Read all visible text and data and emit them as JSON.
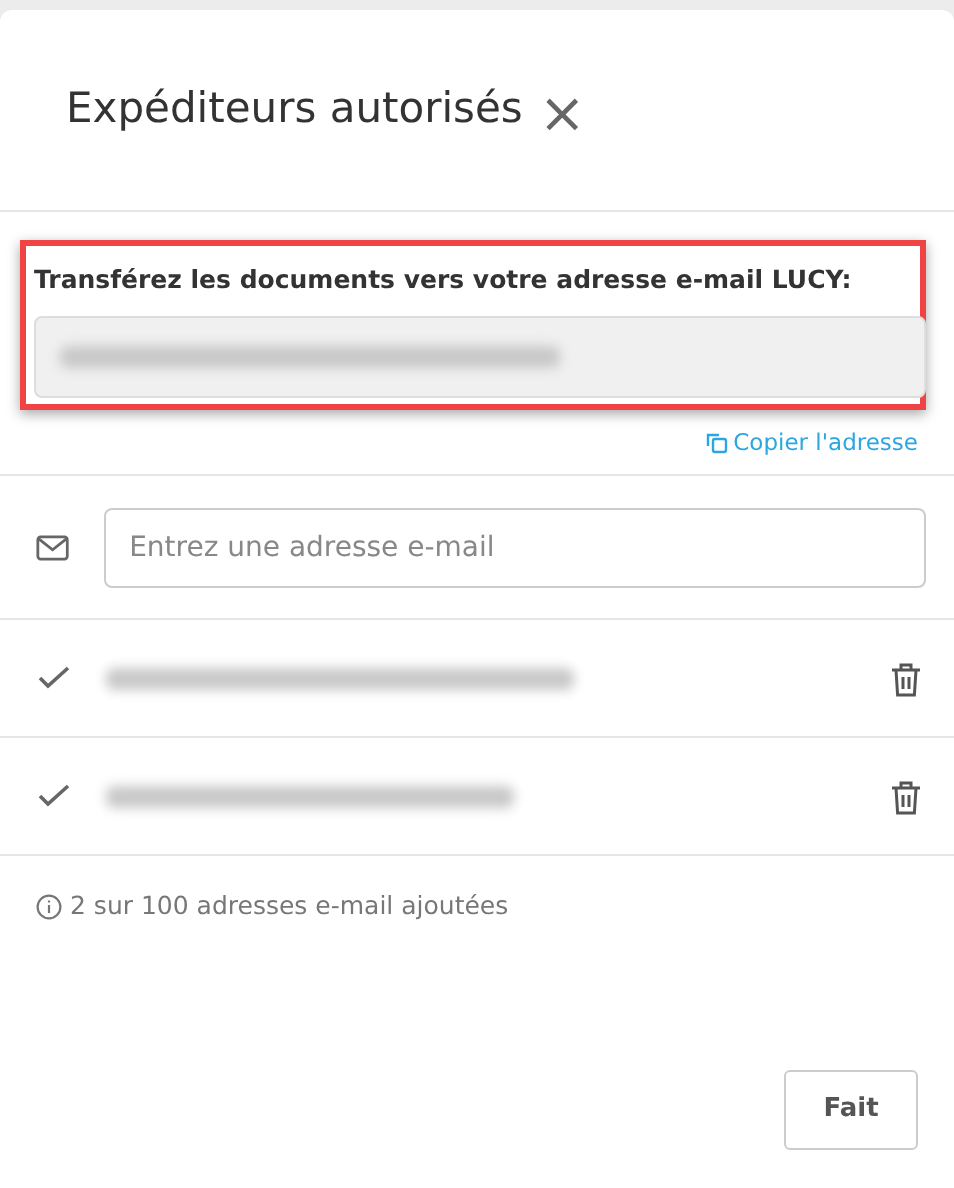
{
  "dialog": {
    "title": "Expéditeurs autorisés",
    "close": "×"
  },
  "forward": {
    "label": "Transférez les documents vers votre adresse e-mail LUCY:",
    "address": {
      "kind": "redacted"
    },
    "highlighted": true,
    "copy_link": "Copier l'adresse"
  },
  "add": {
    "placeholder": "Entrez une adresse e-mail"
  },
  "senders": [
    {
      "verified": true,
      "address": {
        "kind": "redacted"
      }
    },
    {
      "verified": true,
      "address": {
        "kind": "redacted"
      }
    }
  ],
  "info": "2 sur 100 adresses e-mail ajoutées",
  "buttons": [
    "Fait"
  ]
}
